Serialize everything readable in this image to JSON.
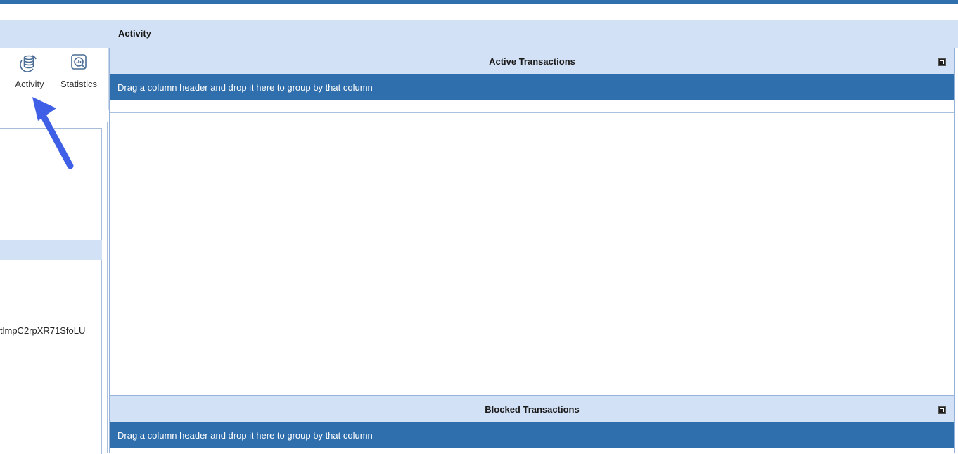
{
  "ribbon": {
    "activity_label": "Activity",
    "statistics_label": "Statistics",
    "activity_icon": "database-sync-icon",
    "statistics_icon": "chart-magnifier-icon"
  },
  "left_panel": {
    "truncated_text": "tlmpC2rpXR71SfoLU"
  },
  "content": {
    "title": "Activity"
  },
  "active_pane": {
    "title": "Active Transactions",
    "group_prompt": "Drag a column header and drop it here to group by that column"
  },
  "blocked_pane": {
    "title": "Blocked Transactions",
    "group_prompt": "Drag a column header and drop it here to group by that column"
  },
  "colors": {
    "accent": "#2f6fad",
    "header_bg": "#d3e1f6",
    "annotation_arrow": "#3f5fe6"
  }
}
